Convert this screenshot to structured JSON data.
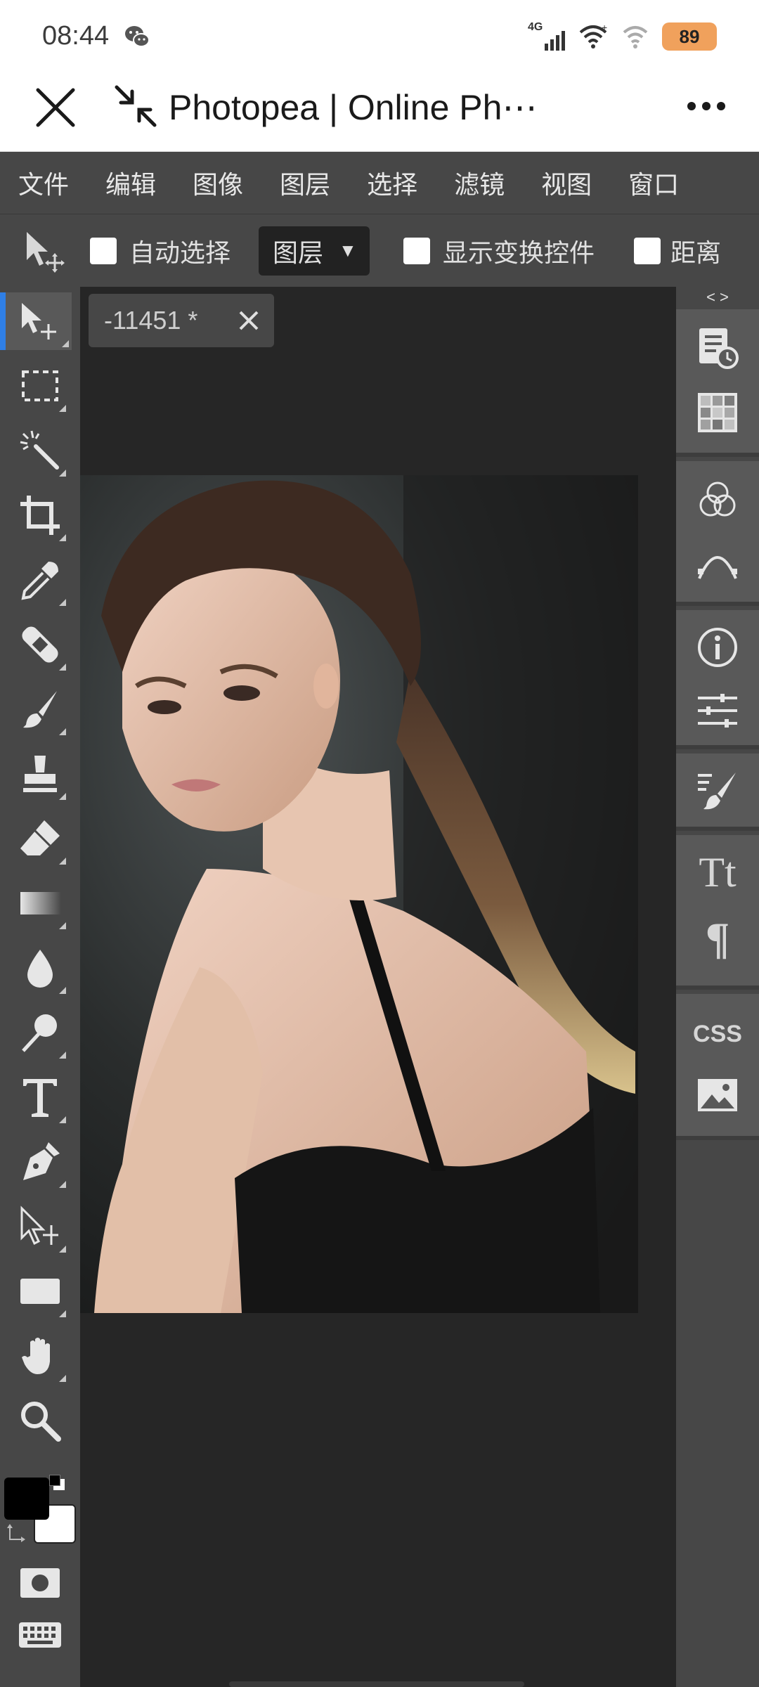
{
  "status_bar": {
    "time": "08:44",
    "network": "4G",
    "battery": "89",
    "icons": [
      "wechat-icon",
      "signal-icon",
      "wifi-icon",
      "battery-icon"
    ]
  },
  "title_bar": {
    "title": "Photopea | Online Ph⋯",
    "icons": [
      "close-icon",
      "minimize-icon",
      "more-icon"
    ]
  },
  "menu": {
    "items": [
      "文件",
      "编辑",
      "图像",
      "图层",
      "选择",
      "滤镜",
      "视图",
      "窗口"
    ]
  },
  "options_bar": {
    "auto_select_label": "自动选择",
    "layer_select_value": "图层",
    "dropdown_arrow": "▼",
    "show_transform_label": "显示变换控件",
    "distance_label": "距离"
  },
  "document": {
    "tab_title": "-11451 *"
  },
  "tools": [
    "move",
    "marquee",
    "magic-wand",
    "crop",
    "eyedropper",
    "healing",
    "brush",
    "stamp",
    "eraser",
    "gradient",
    "blur",
    "dodge",
    "type",
    "pen",
    "path-select",
    "shape",
    "hand",
    "zoom",
    "colors",
    "quick-mask",
    "keyboard"
  ],
  "right_panel": {
    "collapse_label": "< >",
    "css_label": "CSS",
    "tt_label": "Tt",
    "pilcrow_label": "¶",
    "buttons": [
      "history",
      "swatches",
      "channels",
      "paths",
      "info",
      "adjustments",
      "brushes",
      "character",
      "paragraph",
      "css",
      "image"
    ]
  },
  "colors": {
    "accent": "#2f7fe6",
    "ui_dark": "#474747",
    "workspace": "#262626",
    "foreground_color": "#000000",
    "background_color": "#ffffff"
  }
}
